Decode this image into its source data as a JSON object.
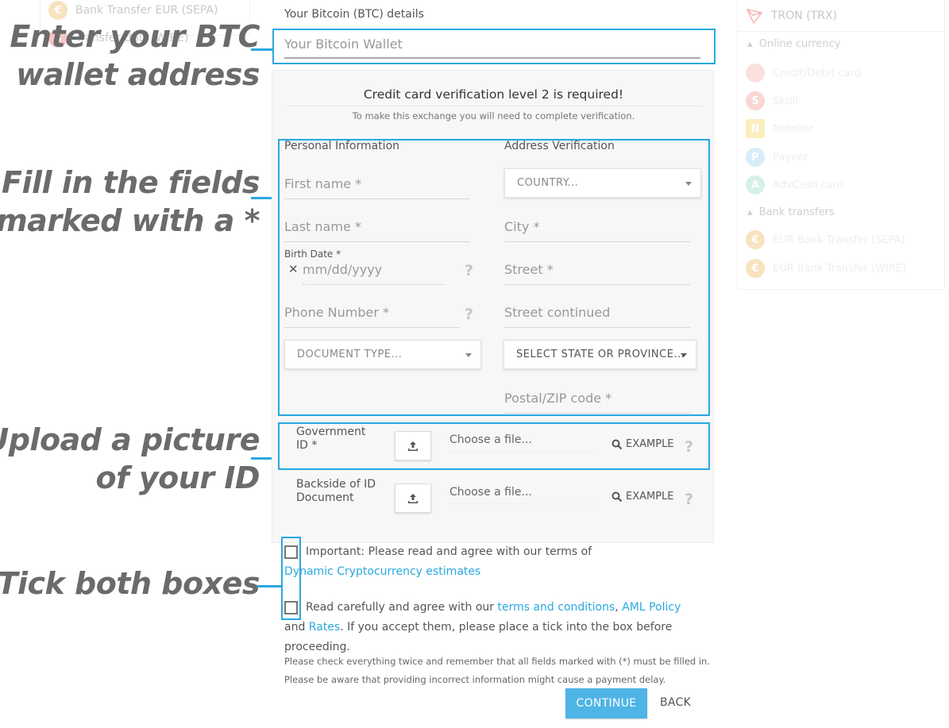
{
  "left_panel": {
    "items": [
      {
        "label": "Bank Transfer EUR (SEPA)",
        "icon": "euro-coin-icon"
      },
      {
        "label": "Transfer USD (WIRE)",
        "icon": "dollar-coin-icon"
      }
    ]
  },
  "right_panel": {
    "header": "TRON (TRX)",
    "section_online": "Online currency",
    "online_items": [
      "Credit/Debit card",
      "Skrill",
      "Neteller",
      "Payeer",
      "AdvCash card"
    ],
    "section_bank": "Bank transfers",
    "bank_items": [
      "EUR Bank Transfer (SEPA)",
      "EUR Bank Transfer (WIRE)"
    ]
  },
  "callouts": {
    "wallet_1": "Enter your BTC",
    "wallet_2": "wallet address",
    "fields_1": "Fill in the fields",
    "fields_2": "marked with a *",
    "upload_1": "Upload a picture",
    "upload_2": "of your ID",
    "tick": "Tick both boxes"
  },
  "accent_color": "#29a8e0",
  "wallet": {
    "label": "Your Bitcoin (BTC) details",
    "placeholder": "Your Bitcoin Wallet"
  },
  "verification": {
    "title": "Credit card verification level 2 is required!",
    "subtitle": "To make this exchange you will need to complete verification."
  },
  "personal": {
    "heading": "Personal Information",
    "first_name": "First name *",
    "last_name": "Last name *",
    "birth_label": "Birth Date *",
    "birth_placeholder": "mm/dd/yyyy",
    "clear_symbol": "✕",
    "phone": "Phone Number *",
    "document_type": "DOCUMENT TYPE...",
    "help_symbol": "?"
  },
  "address": {
    "heading": "Address Verification",
    "country": "COUNTRY...",
    "city": "City *",
    "street": "Street *",
    "street2": "Street continued",
    "state": "SELECT STATE OR PROVINCE...",
    "zip": "Postal/ZIP code *"
  },
  "uploads": [
    {
      "label_1": "Government",
      "label_2": "ID *",
      "choose": "Choose a file...",
      "example": "EXAMPLE"
    },
    {
      "label_1": "Backside of ID",
      "label_2": "Document",
      "choose": "Choose a file...",
      "example": "EXAMPLE"
    }
  ],
  "agreements": {
    "first_text": "Important: Please read and agree with our terms of ",
    "first_link": "Dynamic Cryptocurrency estimates",
    "second_text": "Read carefully and agree with our ",
    "terms_link": "terms and conditions",
    "comma": ", ",
    "aml_link": "AML Policy",
    "and_text": " and",
    "rates_link": "Rates",
    "second_tail": ". If you accept them, please place a tick into the box before proceeding."
  },
  "notes": [
    "Please check everything twice and remember that all fields marked with (*) must be filled in.",
    "Please be aware that providing incorrect information might cause a payment delay."
  ],
  "buttons": {
    "continue": "CONTINUE",
    "back": "BACK"
  }
}
